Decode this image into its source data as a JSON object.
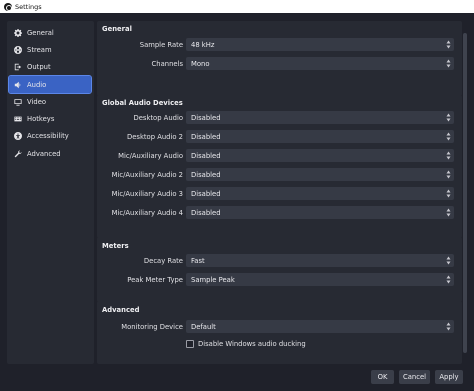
{
  "window": {
    "title": "Settings"
  },
  "sidebar": {
    "items": [
      {
        "label": "General",
        "icon": "gear-icon"
      },
      {
        "label": "Stream",
        "icon": "globe-icon"
      },
      {
        "label": "Output",
        "icon": "output-icon"
      },
      {
        "label": "Audio",
        "icon": "speaker-icon",
        "active": true
      },
      {
        "label": "Video",
        "icon": "monitor-icon"
      },
      {
        "label": "Hotkeys",
        "icon": "keyboard-icon"
      },
      {
        "label": "Accessibility",
        "icon": "accessibility-icon"
      },
      {
        "label": "Advanced",
        "icon": "wrench-icon"
      }
    ]
  },
  "general": {
    "title": "General",
    "sample_rate_label": "Sample Rate",
    "sample_rate_value": "48 kHz",
    "channels_label": "Channels",
    "channels_value": "Mono"
  },
  "global_audio": {
    "title": "Global Audio Devices",
    "rows": [
      {
        "label": "Desktop Audio",
        "value": "Disabled"
      },
      {
        "label": "Desktop Audio 2",
        "value": "Disabled"
      },
      {
        "label": "Mic/Auxiliary Audio",
        "value": "Disabled"
      },
      {
        "label": "Mic/Auxiliary Audio 2",
        "value": "Disabled"
      },
      {
        "label": "Mic/Auxiliary Audio 3",
        "value": "Disabled"
      },
      {
        "label": "Mic/Auxiliary Audio 4",
        "value": "Disabled"
      }
    ]
  },
  "meters": {
    "title": "Meters",
    "decay_rate_label": "Decay Rate",
    "decay_rate_value": "Fast",
    "peak_meter_label": "Peak Meter Type",
    "peak_meter_value": "Sample Peak"
  },
  "advanced": {
    "title": "Advanced",
    "monitoring_label": "Monitoring Device",
    "monitoring_value": "Default",
    "ducking_label": "Disable Windows audio ducking",
    "ducking_checked": false
  },
  "footer": {
    "ok": "OK",
    "cancel": "Cancel",
    "apply": "Apply"
  },
  "colors": {
    "accent": "#3a63c4",
    "background": "#1f212a",
    "panel": "#272a33",
    "control": "#363a45"
  }
}
